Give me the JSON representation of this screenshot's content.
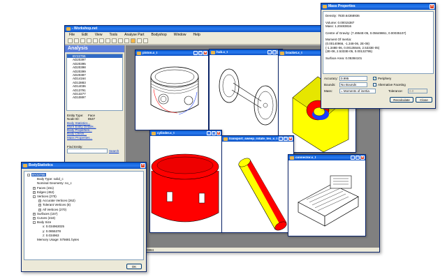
{
  "main_window": {
    "title": "- Workshop.net",
    "menu": [
      "File",
      "Edit",
      "View",
      "Tools",
      "Analyse Part",
      "Bodyshop",
      "Window",
      "Help"
    ],
    "status_text": "0884"
  },
  "analysis_panel": {
    "title": "Analysis",
    "entities": [
      "BY22755",
      "AD20397",
      "AD20395",
      "AD20398",
      "AD20399",
      "AD20387",
      "AD14164",
      "AD13883",
      "AD14036",
      "AD13791",
      "AD13277",
      "AD10897"
    ],
    "entity_type_label": "Entity Type:",
    "entity_type_value": "Face",
    "node_id_label": "Node ID:",
    "node_id_value": "8537",
    "links": [
      "Body Statistics...",
      "More Entity Details...",
      "Body Properties...",
      "Body Check...",
      "Mass Properties..."
    ],
    "find_label": "Find Entity:",
    "search_label": "Search",
    "radio_node": "By Node ID",
    "radio_tag": "By Tag"
  },
  "child_windows": {
    "piston": "piston.x_t",
    "hub": "hub.x_t",
    "bracket": "bracket.x_t",
    "cylinder": "cylinder.x_t",
    "transport": "transport_sweep_rotate_tes_x_t",
    "connector": "connector.x_t"
  },
  "mass_properties": {
    "title": "Mass Properties",
    "density": "Density: 7830.64368936",
    "volume": "Volume: 0.00015387",
    "mass": "Mass: 1.20483816",
    "cog_label": "Centre of Gravity: (7.4954E-05, 0.05649861, 0.00035107)",
    "moi_label": "Moment Of Inertia:",
    "moi_1": "(0.00140966, -1.348-06, 2E-08)",
    "moi_2": "(-1.348E-06, 0.00135546, 2.5333E-05)",
    "moi_3": "(2E-08, 2.5333E-05, 0.00132795)",
    "surface_area": "Surface Area: 0.05384101",
    "accuracy_label": "Accuracy:",
    "accuracy_value": "0.995",
    "periphery_label": "Periphery",
    "bounds_label": "Bounds:",
    "bounds_value": "No Bounds",
    "alt_facet_label": "Alternative Faceting",
    "mass_label": "Mass:",
    "mass_value": "= Moments of inertia",
    "tolerance_label": "Tolerance:",
    "tolerance_value": "0.0",
    "recalc_label": "Recalculate",
    "close_label": "Close"
  },
  "body_statistics": {
    "title": "BodyStatistics",
    "tree": [
      {
        "text": "BY22755",
        "level": 0,
        "toggle": "-",
        "selected": true
      },
      {
        "text": "Body Type: solid_c",
        "level": 1,
        "toggle": ""
      },
      {
        "text": "Nominal Geometry: no_c",
        "level": 1,
        "toggle": ""
      },
      {
        "text": "Faces (151)",
        "level": 1,
        "toggle": "+"
      },
      {
        "text": "Edges (452)",
        "level": 1,
        "toggle": "+"
      },
      {
        "text": "Vertices (270)",
        "level": 1,
        "toggle": "-"
      },
      {
        "text": "Accurate Vertices (262)",
        "level": 2,
        "toggle": "+"
      },
      {
        "text": "Tolerant Vertices (8)",
        "level": 2,
        "toggle": "+"
      },
      {
        "text": "All Vertices (270)",
        "level": 2,
        "toggle": "+"
      },
      {
        "text": "Surfaces (157)",
        "level": 1,
        "toggle": "+"
      },
      {
        "text": "Curves (418)",
        "level": 1,
        "toggle": "+"
      },
      {
        "text": "Body Size",
        "level": 1,
        "toggle": "-"
      },
      {
        "text": "x: 0.034963025",
        "level": 2,
        "toggle": ""
      },
      {
        "text": "y: 0.0855378",
        "level": 2,
        "toggle": ""
      },
      {
        "text": "z: 0.034963",
        "level": 2,
        "toggle": ""
      },
      {
        "text": "Memory Usage: 575681 bytes",
        "level": 1,
        "toggle": ""
      }
    ],
    "ok_label": "OK"
  },
  "colors": {
    "titlebar": "#0a5fd6",
    "shape_red": "#ff0000",
    "shape_yellow": "#ffff00",
    "shape_blue": "#1a3cff"
  }
}
